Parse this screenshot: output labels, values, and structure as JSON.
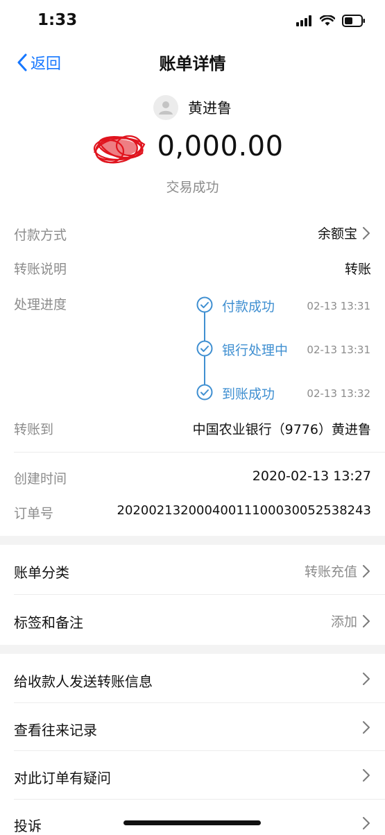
{
  "status_bar": {
    "time": "1:33"
  },
  "nav": {
    "back_label": "返回",
    "title": "账单详情"
  },
  "header": {
    "payee_name": "黄进鲁",
    "amount_visible": "0,000.00",
    "status": "交易成功"
  },
  "details": {
    "payment_method": {
      "label": "付款方式",
      "value": "余额宝"
    },
    "transfer_note": {
      "label": "转账说明",
      "value": "转账"
    },
    "progress": {
      "label": "处理进度",
      "steps": [
        {
          "name": "付款成功",
          "time": "02-13 13:31"
        },
        {
          "name": "银行处理中",
          "time": "02-13 13:31"
        },
        {
          "name": "到账成功",
          "time": "02-13 13:32"
        }
      ]
    },
    "transfer_to": {
      "label": "转账到",
      "value": "中国农业银行（9776）黄进鲁"
    },
    "created_time": {
      "label": "创建时间",
      "value": "2020-02-13 13:27"
    },
    "order_no": {
      "label": "订单号",
      "value": "20200213200040011100030052538243"
    }
  },
  "settings": {
    "category": {
      "label": "账单分类",
      "value": "转账充值"
    },
    "tags": {
      "label": "标签和备注",
      "value": "添加"
    }
  },
  "actions": [
    {
      "label": "给收款人发送转账信息"
    },
    {
      "label": "查看往来记录"
    },
    {
      "label": "对此订单有疑问"
    },
    {
      "label": "投诉"
    }
  ],
  "colors": {
    "accent": "#1677ff",
    "progress": "#3f8fd1",
    "muted": "#8c8c8c",
    "redaction": "#e0141e"
  }
}
